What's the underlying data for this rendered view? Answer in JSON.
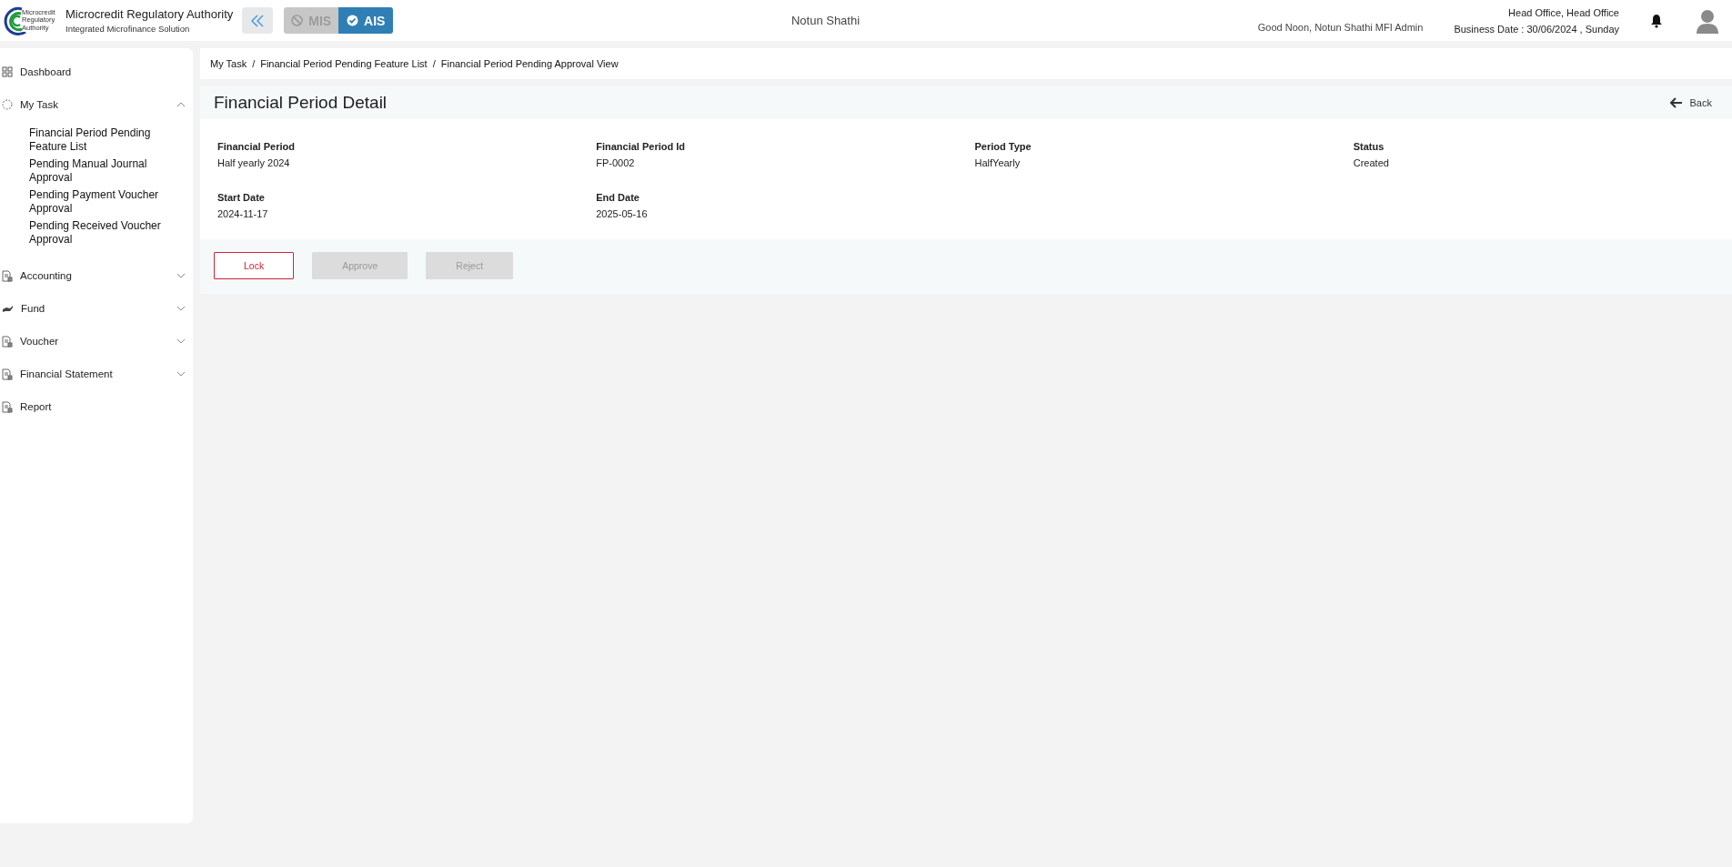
{
  "header": {
    "logo_text": [
      "Microcredit",
      "Regulatory",
      "Authority"
    ],
    "title": "Microcredit Regulatory Authority",
    "subtitle": "Integrated Microfinance Solution",
    "modules": [
      {
        "label": "MIS",
        "selected": false
      },
      {
        "label": "AIS",
        "selected": true
      }
    ],
    "org_name": "Notun Shathi",
    "greeting": "Good Noon, Notun Shathi MFI Admin",
    "office": "Head Office, Head Office",
    "business_date": "Business Date : 30/06/2024 , Sunday"
  },
  "sidebar": {
    "items": [
      {
        "label": "Dashboard",
        "kind": "link"
      },
      {
        "label": "My Task",
        "kind": "group",
        "expanded": true,
        "children": [
          {
            "label": "Financial Period Pending Feature List"
          },
          {
            "label": "Pending Manual Journal Approval"
          },
          {
            "label": "Pending Payment Voucher Approval"
          },
          {
            "label": "Pending Received Voucher Approval"
          }
        ]
      },
      {
        "label": "Accounting",
        "kind": "group",
        "expanded": false
      },
      {
        "label": "Fund",
        "kind": "group",
        "expanded": false
      },
      {
        "label": "Voucher",
        "kind": "group",
        "expanded": false
      },
      {
        "label": "Financial Statement",
        "kind": "group",
        "expanded": false
      },
      {
        "label": "Report",
        "kind": "link"
      }
    ]
  },
  "breadcrumb": {
    "items": [
      "My Task",
      "Financial Period Pending Feature List",
      "Financial Period Pending Approval View"
    ],
    "separators": [
      "/",
      "/"
    ]
  },
  "detail": {
    "title": "Financial Period Detail",
    "back": "Back",
    "fields": [
      {
        "label": "Financial Period",
        "value": "Half yearly 2024"
      },
      {
        "label": "Financial Period Id",
        "value": "FP-0002"
      },
      {
        "label": "Period Type",
        "value": "HalfYearly"
      },
      {
        "label": "Status",
        "value": "Created"
      },
      {
        "label": "Start Date",
        "value": "2024-11-17"
      },
      {
        "label": "End Date",
        "value": "2025-05-16"
      }
    ],
    "buttons": [
      {
        "label": "Lock",
        "kind": "outline",
        "disabled": false
      },
      {
        "label": "Approve",
        "kind": "plain",
        "disabled": true
      },
      {
        "label": "Reject",
        "kind": "plain",
        "disabled": true
      }
    ]
  }
}
